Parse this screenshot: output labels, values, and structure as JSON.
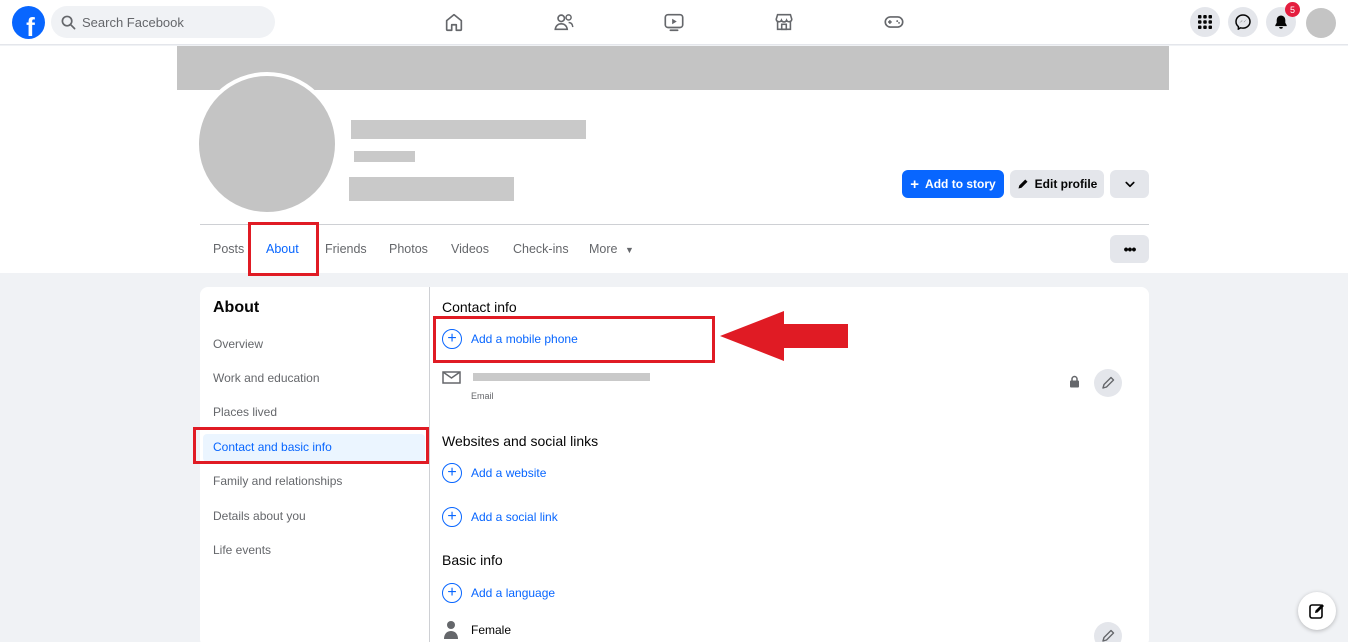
{
  "brand": {
    "logo_letter": "f",
    "color": "#0866ff"
  },
  "search": {
    "placeholder": "Search Facebook"
  },
  "nav_icons": [
    "home-icon",
    "friends-icon",
    "video-icon",
    "marketplace-icon",
    "gaming-icon"
  ],
  "notifications": {
    "count": "5"
  },
  "actions": {
    "add_story": "Add to story",
    "edit_profile": "Edit profile"
  },
  "tabs": [
    {
      "label": "Posts"
    },
    {
      "label": "About"
    },
    {
      "label": "Friends"
    },
    {
      "label": "Photos"
    },
    {
      "label": "Videos"
    },
    {
      "label": "Check-ins"
    },
    {
      "label": "More"
    }
  ],
  "about": {
    "title": "About",
    "items": [
      {
        "label": "Overview"
      },
      {
        "label": "Work and education"
      },
      {
        "label": "Places lived"
      },
      {
        "label": "Contact and basic info"
      },
      {
        "label": "Family and relationships"
      },
      {
        "label": "Details about you"
      },
      {
        "label": "Life events"
      }
    ]
  },
  "contact": {
    "title": "Contact info",
    "add_phone": "Add a mobile phone",
    "email_label": "Email"
  },
  "websites": {
    "title": "Websites and social links",
    "add_website": "Add a website",
    "add_social": "Add a social link"
  },
  "basic": {
    "title": "Basic info",
    "add_language": "Add a language",
    "gender": "Female"
  },
  "annotation_color": "#e01b24"
}
